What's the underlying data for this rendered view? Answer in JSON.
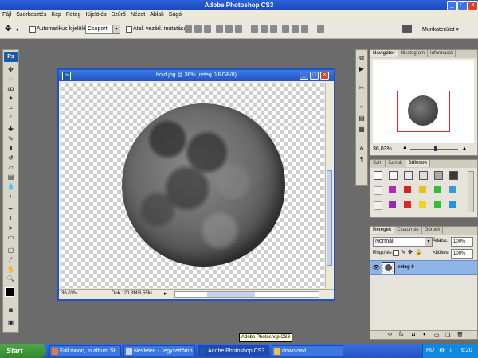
{
  "app": {
    "title": "Adobe Photoshop CS3",
    "brand_color": "#2353c2"
  },
  "menu": [
    "Fájl",
    "Szerkesztés",
    "Kép",
    "Réteg",
    "Kijelölés",
    "Szűrő",
    "Nézet",
    "Ablak",
    "Súgó"
  ],
  "options": {
    "auto_select_label": "Automatikus kijelölés:",
    "auto_select_value": "Csoport",
    "transform_label": "Átal. vezérl. mutatása",
    "workspace_label": "Munkaterület"
  },
  "document": {
    "title": "hold.jpg @ 36% (réteg 0,RGB/8)",
    "zoom": "36,03%",
    "doc_size": "Dok.: 20,3M/6,55M"
  },
  "navigator": {
    "tabs": [
      "Navigátor",
      "Hisztogram",
      "Információ"
    ],
    "zoom": "36,03%"
  },
  "swatches": {
    "tabs": [
      "Szín",
      "Szintár",
      "Stílusok"
    ]
  },
  "layers": {
    "tabs": [
      "Rétegek",
      "Csatornák",
      "Görbék"
    ],
    "blend_mode": "Normál",
    "opacity_label": "Átlátsz.:",
    "opacity": "100%",
    "lock_label": "Rögzítés:",
    "fill_label": "Kitöltés:",
    "fill": "100%",
    "layer_name": "réteg 0"
  },
  "tooltip": "Adobe Photoshop CS3",
  "taskbar": {
    "start": "Start",
    "items": [
      {
        "label": "Full moon, in album St..."
      },
      {
        "label": "Névtelen - Jegyzettömb"
      },
      {
        "label": "Adobe Photoshop CS3"
      },
      {
        "label": "download"
      }
    ],
    "lang": "HU",
    "clock": "6:20"
  }
}
